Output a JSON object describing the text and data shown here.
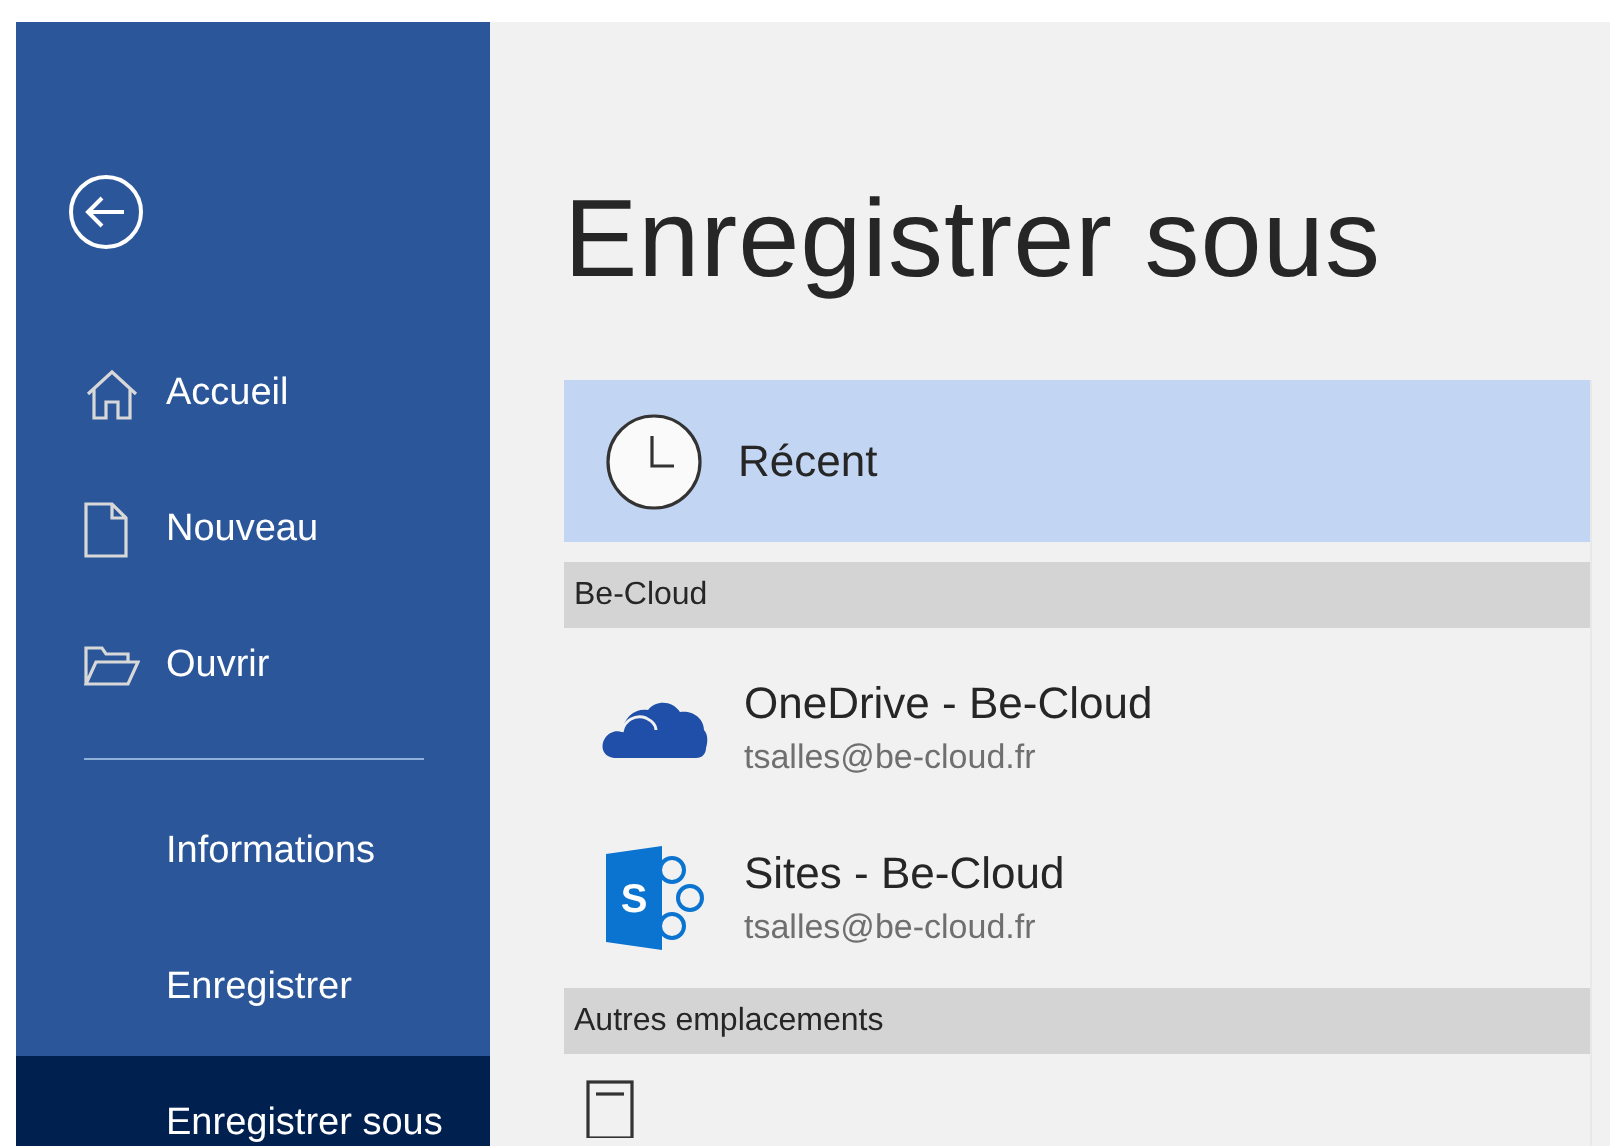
{
  "sidebar": {
    "items": [
      {
        "kind": "home",
        "label": "Accueil",
        "selected": false
      },
      {
        "kind": "document",
        "label": "Nouveau",
        "selected": false
      },
      {
        "kind": "folder",
        "label": "Ouvrir",
        "selected": false
      },
      {
        "kind": "divider"
      },
      {
        "kind": "text",
        "label": "Informations",
        "selected": false
      },
      {
        "kind": "text",
        "label": "Enregistrer",
        "selected": false
      },
      {
        "kind": "text",
        "label": "Enregistrer sous",
        "selected": true
      }
    ]
  },
  "page_title": "Enregistrer sous",
  "locations": [
    {
      "kind": "recent",
      "label": "Récent",
      "selected": true
    },
    {
      "kind": "header",
      "label": "Be-Cloud"
    },
    {
      "kind": "onedrive",
      "label": "OneDrive - Be-Cloud",
      "account": "tsalles@be-cloud.fr",
      "selected": false
    },
    {
      "kind": "sharepoint",
      "label": "Sites - Be-Cloud",
      "account": "tsalles@be-cloud.fr",
      "logo_letter": "S",
      "selected": false
    },
    {
      "kind": "header",
      "label": "Autres emplacements"
    },
    {
      "kind": "pc",
      "selected": false
    }
  ]
}
